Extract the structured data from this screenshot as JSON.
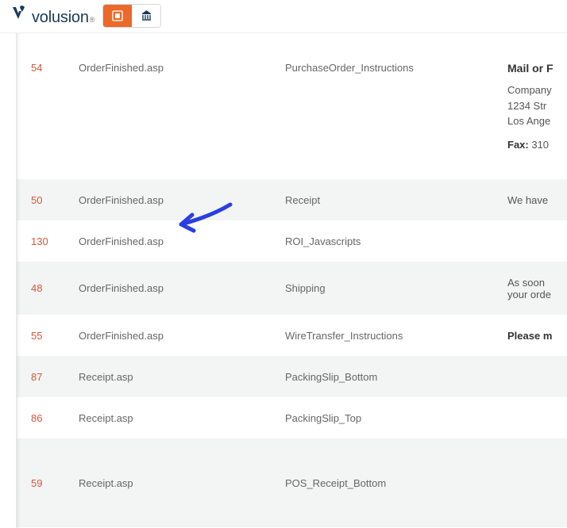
{
  "brand": {
    "name": "volusion"
  },
  "rows": [
    {
      "id": "54",
      "page": "OrderFinished.asp",
      "name": "PurchaseOrder_Instructions",
      "extra_heading": "Mail or F",
      "extra_lines": [
        "Company",
        "1234 Str",
        "Los Ange"
      ],
      "extra_fax_label": "Fax:",
      "extra_fax_value": " 310",
      "alt": false,
      "big": true
    },
    {
      "id": "50",
      "page": "OrderFinished.asp",
      "name": "Receipt",
      "extra_text": "We have",
      "alt": true
    },
    {
      "id": "130",
      "page": "OrderFinished.asp",
      "name": "ROI_Javascripts",
      "extra_text": "",
      "alt": false
    },
    {
      "id": "48",
      "page": "OrderFinished.asp",
      "name": "Shipping",
      "extra_lines2": [
        "As soon",
        "your orde"
      ],
      "alt": true
    },
    {
      "id": "55",
      "page": "OrderFinished.asp",
      "name": "WireTransfer_Instructions",
      "extra_bold": "Please m",
      "alt": false
    },
    {
      "id": "87",
      "page": "Receipt.asp",
      "name": "PackingSlip_Bottom",
      "extra_text": "",
      "alt": true
    },
    {
      "id": "86",
      "page": "Receipt.asp",
      "name": "PackingSlip_Top",
      "extra_text": "",
      "alt": false
    },
    {
      "id": "59",
      "page": "Receipt.asp",
      "name": "POS_Receipt_Bottom",
      "extra_text": "",
      "alt": true,
      "tall": true
    }
  ]
}
